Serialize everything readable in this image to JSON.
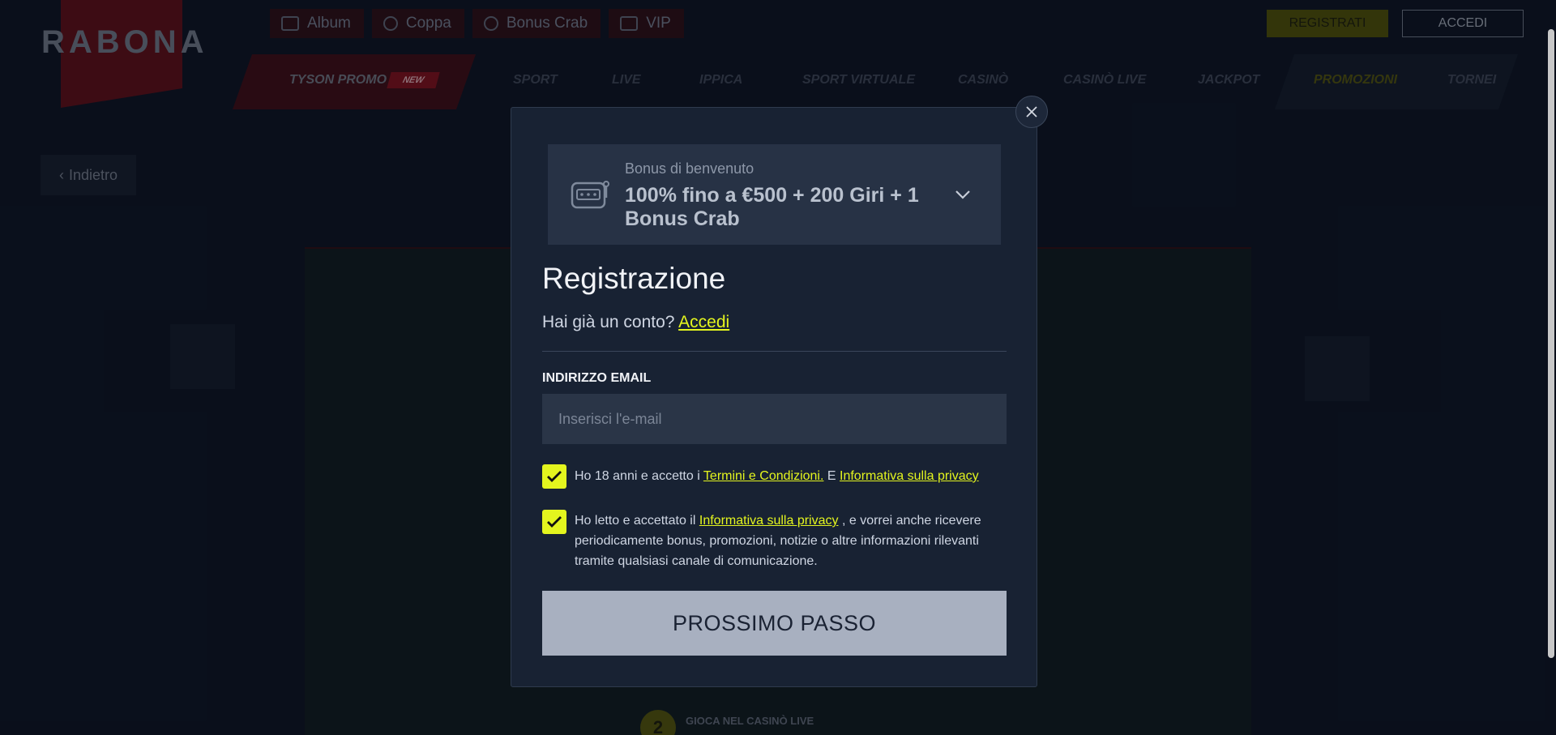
{
  "brand": {
    "logo_text": "RABONA"
  },
  "top_links": [
    {
      "label": "Album",
      "icon": "book-icon"
    },
    {
      "label": "Coppa",
      "icon": "trophy-icon"
    },
    {
      "label": "Bonus Crab",
      "icon": "crab-icon"
    },
    {
      "label": "VIP",
      "icon": "diamond-icon"
    }
  ],
  "auth_buttons": {
    "register": "REGISTRATI",
    "login": "ACCEDI"
  },
  "nav": {
    "promo": "TYSON PROMO",
    "new_badge": "NEW",
    "items": [
      "SPORT",
      "LIVE",
      "IPPICA",
      "SPORT VIRTUALE",
      "CASINÒ",
      "CASINÒ LIVE",
      "JACKPOT",
      "PROMOZIONI",
      "TORNEI"
    ]
  },
  "back_button": "Indietro",
  "step": {
    "number": "2",
    "title": "GIOCA NEL CASINÒ LIVE"
  },
  "modal": {
    "bonus": {
      "subtitle": "Bonus di benvenuto",
      "main": "100% fino a €500 + 200 Giri + 1 Bonus Crab"
    },
    "title": "Registrazione",
    "have_account_text": "Hai già un conto?",
    "login_link": "Accedi",
    "email_label": "INDIRIZZO EMAIL",
    "email_placeholder": "Inserisci l'e-mail",
    "email_value": "",
    "consent1": {
      "prefix": "Ho 18 anni e accetto i",
      "terms_link": "Termini e Condizioni.",
      "middle": "E",
      "privacy_link": "Informativa sulla privacy",
      "checked": true
    },
    "consent2": {
      "prefix": "Ho letto e accettato il",
      "privacy_link": "Informativa sulla privacy",
      "suffix": ", e vorrei anche ricevere periodicamente bonus, promozioni, notizie o altre informazioni rilevanti tramite qualsiasi canale di comunicazione.",
      "checked": true
    },
    "next_button": "PROSSIMO PASSO"
  },
  "colors": {
    "accent": "#e4f51e",
    "modal_bg": "#182233",
    "button_bg": "#a8b0c0"
  }
}
